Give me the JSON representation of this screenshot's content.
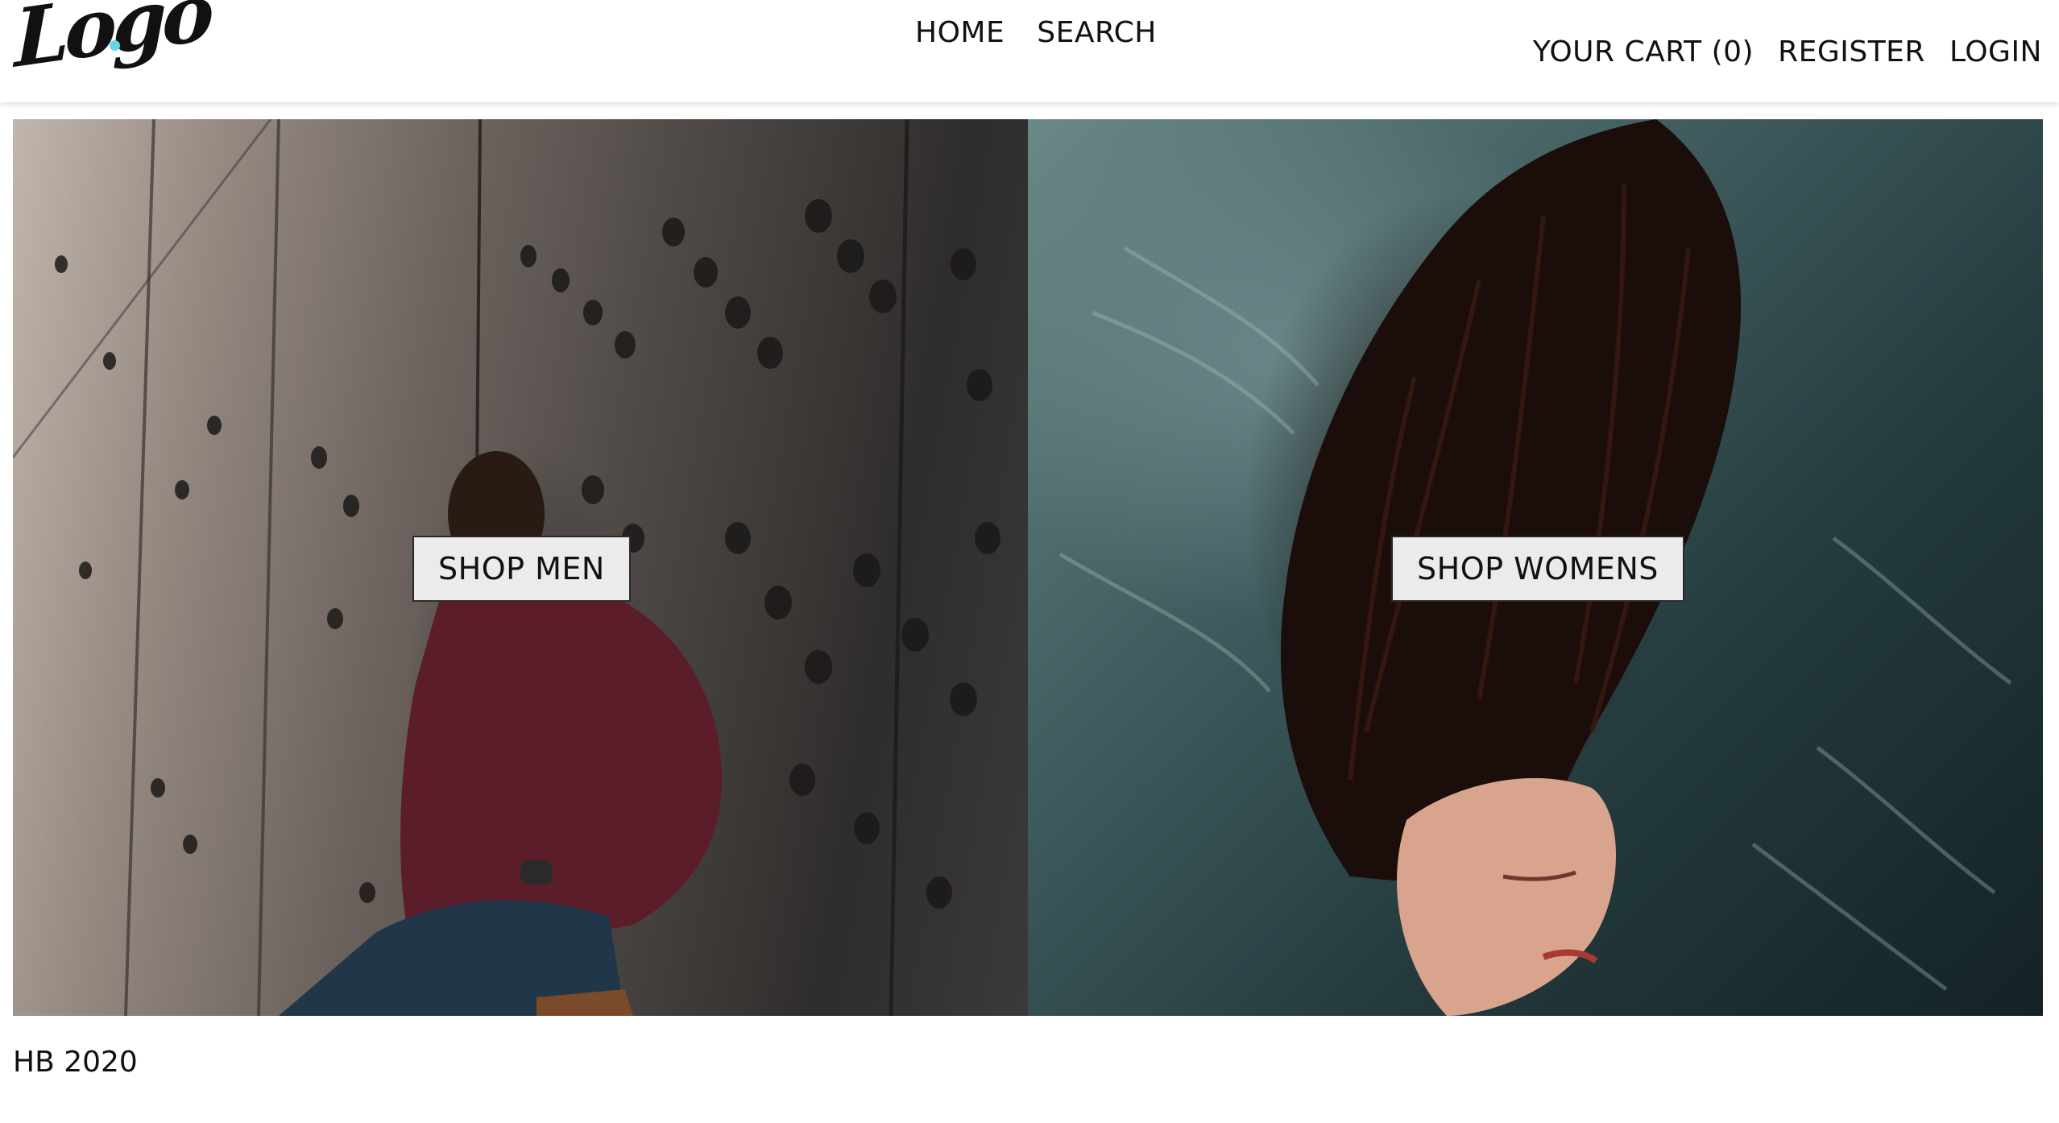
{
  "header": {
    "logo_text": "Logo",
    "nav_center": [
      {
        "label": "HOME"
      },
      {
        "label": "SEARCH"
      }
    ],
    "nav_right": [
      {
        "label": "YOUR CART (0)"
      },
      {
        "label": "REGISTER"
      },
      {
        "label": "LOGIN"
      }
    ]
  },
  "hero": {
    "men": {
      "button_label": "SHOP MEN",
      "image_icon": "man-leaning-on-perforated-wall-photo"
    },
    "women": {
      "button_label": "SHOP WOMENS",
      "image_icon": "woman-hair-flying-photo"
    }
  },
  "footer": {
    "text": "HB 2020"
  },
  "colors": {
    "logo_dot": "#63d8e0",
    "button_bg": "#ebebeb",
    "text": "#111111"
  }
}
